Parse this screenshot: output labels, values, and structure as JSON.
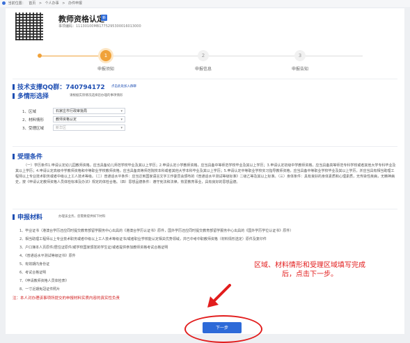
{
  "breadcrumb": {
    "prefix": "当前位置：",
    "items": [
      "首页",
      ">",
      "个人办事",
      ">",
      "办件申报"
    ]
  },
  "header": {
    "title": "教师资格认定",
    "badge": "新",
    "code": "事项编码：11130100MB1775295300016013000"
  },
  "steps": [
    {
      "num": "1",
      "label": "申报须知"
    },
    {
      "num": "2",
      "label": "申报信息"
    },
    {
      "num": "3",
      "label": "申报告知"
    }
  ],
  "support": {
    "title": "技术支撑QQ群：740794172",
    "hint": "点击此处加入群聊"
  },
  "situation": {
    "title": "多情形选择",
    "hint": "请根据实际情况选择您办理的事项情形",
    "fields": [
      {
        "label": "1、区域",
        "value": "石家庄市行政审批局"
      },
      {
        "label": "2、材料情形",
        "value": "教师资格认定"
      },
      {
        "label": "3、受理区域",
        "value": "",
        "placeholder": "新华区"
      }
    ]
  },
  "conditions": {
    "title": "受理条件",
    "text": "（一）学历条件1.申请认定幼儿园教师资格，应当具备幼儿师范学校毕业及其以上学历；2.申请认定小学教师资格，应当具备中等师范学校毕业及其以上学历；3.申请认定初级中学教师资格，应当具备高等师范专科学校或者其他大学专科毕业及其以上学历；4.申请认定高级中学教师资格和中等职业学校教师资格，应当具备高等师范院校本科或者其他大学本科毕业及其以上学历；5.申请认定中等职业学校实习指导教师资格，应当具备中等职业学校毕业及其以上学历，并应当具有相当助理工程师以上专业技术职务或者中级以上工人技术等级。（二）普通话水平条件：应当达到国家语言文字工作委员会颁布的《普通话水平测试等级标准》二级乙等及其以上标准。（三）身体条件：具有良好的身体素质和心理素质，无传染性疾病，无精神病史，按《申请认定教师资格人员体检标准及办法》规定的体检合格。（四）思想品德条件：遵守宪法和法律，热爱教育事业，具有良好的思想品德。"
  },
  "materials": {
    "title": "申报材料",
    "hint": "办理该业务，您需要提供如下材料",
    "items": [
      "1、毕业证书（港澳台学历还应同时提交教育部留学服务中心出具的《港澳台学历认证书》原件，国外学历还应同时提交教育部留学服务中心出具的《国外学历学位认证书》原件）",
      "2、相当助理工程师以上专业技术职务或者中级以上工人技术等级证书/或者职业学校能认定相关优势领域，并已中考中职教师资格（材料情形选定）原件及复印件",
      "3、户口簿本人页原件/居住证原件/或学校国家颁发的学生证/或者提供参加教师资格考试合格证明",
      "4、《普通话水平测试等级证书》原件",
      "5、有效期内身份证",
      "6、考试合格证明",
      "7、《申请教师资格人员体检表》",
      "8、一寸近期免冠证件照片"
    ],
    "note": "注：本人对办理该事项所提交的申报材料实质内容的真实性负责"
  },
  "annotation": "区域、材料情形和受理区域填写完成后，点击下一步。",
  "actions": {
    "next_label": "下一步"
  },
  "colors": {
    "primary": "#2d6ad8",
    "accent": "#f0a23a",
    "annotation": "#e21d1d"
  }
}
